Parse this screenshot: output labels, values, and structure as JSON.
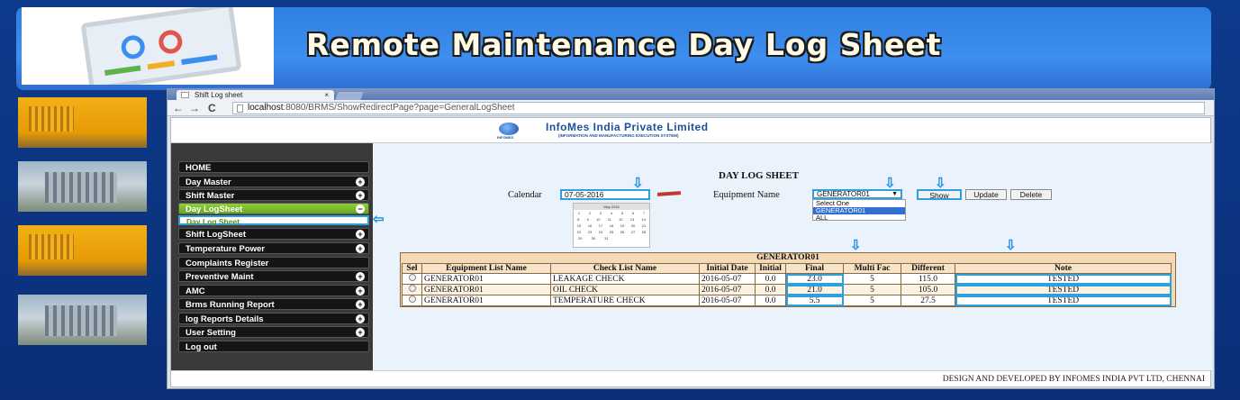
{
  "banner": {
    "title": "Remote Maintenance Day Log Sheet"
  },
  "browser": {
    "tab_title": "Shift Log sheet",
    "tab_close": "×",
    "back": "←",
    "forward": "→",
    "reload": "C",
    "url_host": "localhost",
    "url_rest": ":8080/BRMS/ShowRedirectPage?page=GeneralLogSheet"
  },
  "header": {
    "company": "InfoMes India Private Limited",
    "company_sub": "(INFORMATION AND MANUFACTURING EXECUTION SYSTEM)",
    "logo_text": "INFOMES"
  },
  "sidebar": {
    "items": [
      {
        "label": "HOME",
        "icon": ""
      },
      {
        "label": "Day Master",
        "icon": "+"
      },
      {
        "label": "Shift Master",
        "icon": "+"
      },
      {
        "label": "Day LogSheet",
        "icon": "−"
      },
      {
        "label": "Shift LogSheet",
        "icon": "+"
      },
      {
        "label": "Temperature Power",
        "icon": "+"
      },
      {
        "label": "Complaints Register",
        "icon": ""
      },
      {
        "label": "Preventive Maint",
        "icon": "+"
      },
      {
        "label": "AMC",
        "icon": "+"
      },
      {
        "label": "Brms Running Report",
        "icon": "+"
      },
      {
        "label": "log Reports Details",
        "icon": "+"
      },
      {
        "label": "User Setting",
        "icon": "+"
      },
      {
        "label": "Log out",
        "icon": ""
      }
    ],
    "submenu_label": "Day Log Sheet"
  },
  "main": {
    "title": "DAY LOG SHEET",
    "calendar_label": "Calendar",
    "calendar_value": "07-05-2016",
    "equipment_label": "Equipment Name",
    "equipment_value": "GENERATOR01",
    "equipment_options": [
      "Select One",
      "GENERATOR01",
      "ALL"
    ],
    "buttons": {
      "show": "Show",
      "update": "Update",
      "delete": "Delete"
    },
    "mini_calendar": {
      "header": "May 2016",
      "rows": [
        [
          "1",
          "2",
          "3",
          "4",
          "5",
          "6",
          "7"
        ],
        [
          "8",
          "9",
          "10",
          "11",
          "12",
          "13",
          "14"
        ],
        [
          "15",
          "16",
          "17",
          "18",
          "19",
          "20",
          "21"
        ],
        [
          "22",
          "23",
          "24",
          "25",
          "26",
          "27",
          "28"
        ],
        [
          "29",
          "30",
          "31",
          "",
          "",
          "",
          ""
        ]
      ]
    }
  },
  "grid": {
    "title": "GENERATOR01",
    "columns": [
      "Sel",
      "Equipment List Name",
      "Check List Name",
      "Initial Date",
      "Initial",
      "Final",
      "Multi Fac",
      "Different",
      "Note"
    ],
    "rows": [
      {
        "equipment": "GENERATOR01",
        "check": "LEAKAGE CHECK",
        "date": "2016-05-07",
        "initial": "0.0",
        "final": "23.0",
        "multi": "5",
        "different": "115.0",
        "note": "TESTED"
      },
      {
        "equipment": "GENERATOR01",
        "check": "OIL CHECK",
        "date": "2016-05-07",
        "initial": "0.0",
        "final": "21.0",
        "multi": "5",
        "different": "105.0",
        "note": "TESTED"
      },
      {
        "equipment": "GENERATOR01",
        "check": "TEMPERATURE CHECK",
        "date": "2016-05-07",
        "initial": "0.0",
        "final": "5.5",
        "multi": "5",
        "different": "27.5",
        "note": "TESTED"
      }
    ]
  },
  "footer": {
    "text": "DESIGN AND DEVELOPED BY INFOMES INDIA PVT LTD, CHENNAI"
  }
}
